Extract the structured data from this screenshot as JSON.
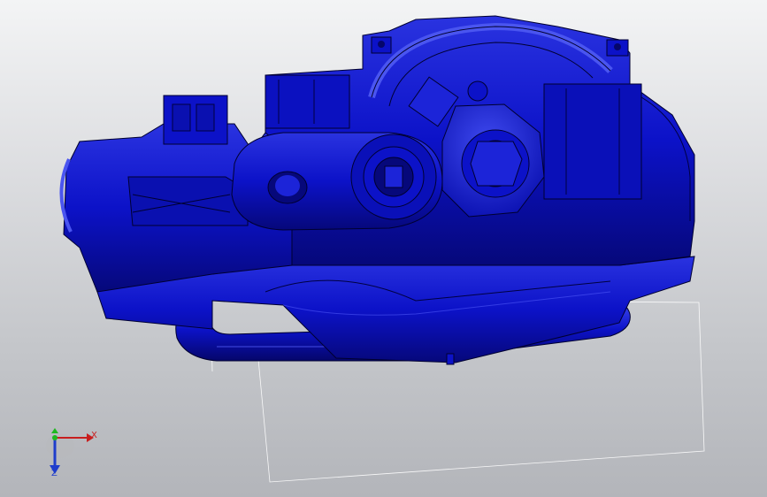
{
  "viewport": {
    "background_top": "#f3f4f5",
    "background_bottom": "#b3b5ba"
  },
  "model": {
    "fill_color": "#0c12c8",
    "edge_color": "#000030",
    "highlight_color": "#4a55f0",
    "shadow_color": "#06087a"
  },
  "triad": {
    "x_axis_label": "X",
    "z_axis_label": "Z",
    "x_color": "#c81e1e",
    "y_color": "#1fb81f",
    "z_color": "#1f3dcc"
  }
}
